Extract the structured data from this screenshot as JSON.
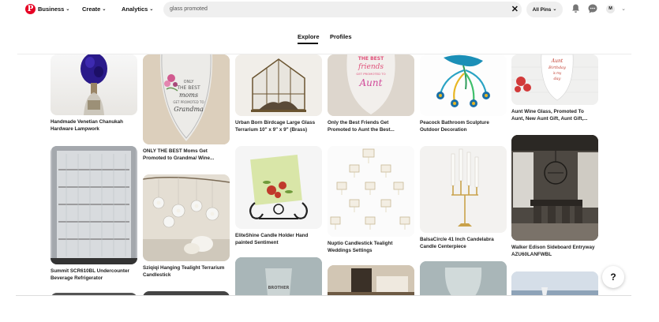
{
  "header": {
    "nav": [
      {
        "label": "Business"
      },
      {
        "label": "Create"
      },
      {
        "label": "Analytics"
      }
    ],
    "search": {
      "value": "glass promoted"
    },
    "filter": {
      "label": "All Pins"
    },
    "avatar_initial": "M"
  },
  "tabs": [
    {
      "label": "Explore",
      "active": true
    },
    {
      "label": "Profiles",
      "active": false
    }
  ],
  "pins": [
    {
      "caption": "Handmade Venetian Chanukah Hardware Lampwork"
    },
    {
      "caption": "ONLY THE BEST Moms Get Promoted to Grandma/ Wine..."
    },
    {
      "caption": "Urban Born Birdcage Large Glass Terrarium 10\" x 9\" x 9\" (Brass)"
    },
    {
      "caption": "Only the Best Friends Get Promoted to Aunt the Best..."
    },
    {
      "caption": "Peacock Bathroom Sculpture Outdoor Decoration"
    },
    {
      "caption": "Aunt Wine Glass, Promoted To Aunt, New Aunt Gift, Aunt Gift,..."
    },
    {
      "caption": "Summit SCR610BL Undercounter Beverage Refrigerator"
    },
    {
      "caption": "Sziqiqi Hanging Tealight Terrarium Candlestick"
    },
    {
      "caption": "EliteShine Candle Holder Hand painted Sentiment"
    },
    {
      "caption": "Nuptio Candlestick Tealight Weddings Settings"
    },
    {
      "caption": "BalsaCircle 41 Inch Candelabra Candle Centerpiece"
    },
    {
      "caption": "Walker Edison Sideboard Entryway AZU60LANFWBL"
    }
  ],
  "pin_text": {
    "friends_glass": [
      "THE BEST",
      "friends",
      "GET PROMOTED TO",
      "Aunt"
    ],
    "moms_glass": [
      "ONLY",
      "THE BEST",
      "moms",
      "GET PROMOTED TO",
      "Grandma"
    ],
    "aunt_glass": [
      "Aunt",
      "Birthday",
      "is my",
      "day"
    ],
    "pint_glass": [
      "BROTHER"
    ]
  },
  "help": {
    "label": "?"
  }
}
